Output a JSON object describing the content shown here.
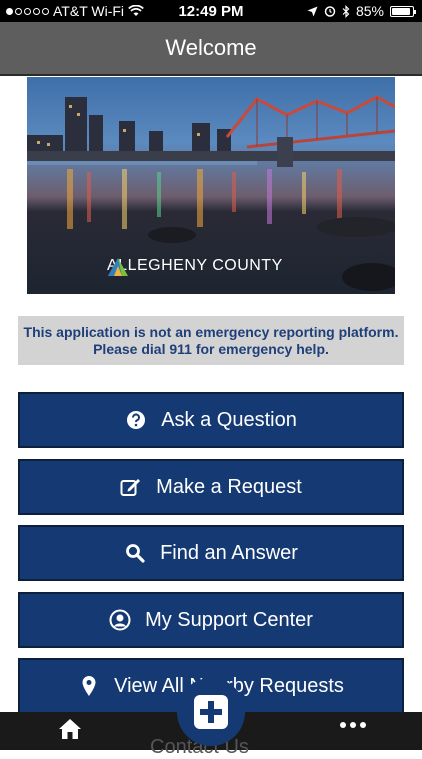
{
  "status_bar": {
    "carrier": "AT&T Wi-Fi",
    "time": "12:49 PM",
    "battery": "85%",
    "battery_level": 0.85
  },
  "header": {
    "title": "Welcome"
  },
  "hero": {
    "logo_text": "ALLEGHENY COUNTY"
  },
  "notice": {
    "line1": "This application is not an emergency reporting platform.",
    "line2": "Please dial 911 for emergency help."
  },
  "buttons": [
    {
      "label": "Ask a Question",
      "icon": "question-circle-icon"
    },
    {
      "label": "Make a Request",
      "icon": "edit-icon"
    },
    {
      "label": "Find an Answer",
      "icon": "search-icon"
    },
    {
      "label": "My Support Center",
      "icon": "user-circle-icon"
    },
    {
      "label": "View All Nearby Requests",
      "icon": "map-pin-icon"
    }
  ],
  "partially_hidden_label": "Contact Us",
  "tab_bar": {
    "home_icon": "home-icon",
    "fab_icon": "plus-square-icon",
    "more_icon": "more-dots-icon"
  },
  "colors": {
    "accent": "#153a73",
    "navbar": "#5e5e5e",
    "notice_bg": "#d3d3d3",
    "notice_text": "#1f3f7a"
  }
}
